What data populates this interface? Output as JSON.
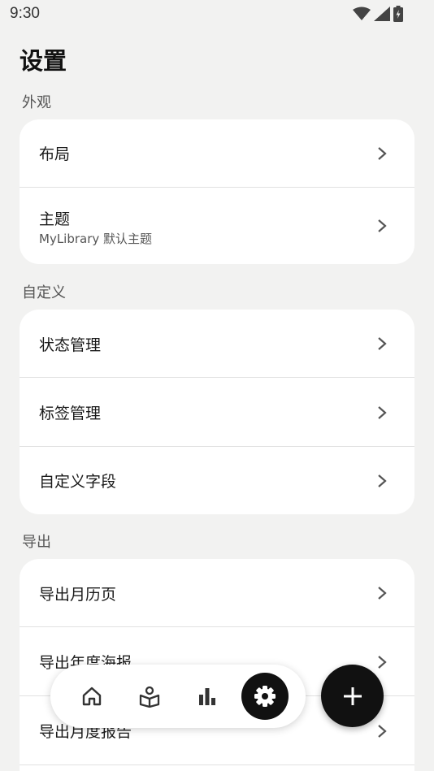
{
  "status_bar": {
    "time": "9:30"
  },
  "page": {
    "title": "设置"
  },
  "sections": [
    {
      "label": "外观",
      "items": [
        {
          "title": "布局"
        },
        {
          "title": "主题",
          "subtitle": "MyLibrary 默认主题"
        }
      ]
    },
    {
      "label": "自定义",
      "items": [
        {
          "title": "状态管理"
        },
        {
          "title": "标签管理"
        },
        {
          "title": "自定义字段"
        }
      ]
    },
    {
      "label": "导出",
      "items": [
        {
          "title": "导出月历页"
        },
        {
          "title": "导出年度海报"
        },
        {
          "title": "导出月度报告"
        }
      ]
    }
  ],
  "bottom_nav": {
    "items": [
      {
        "icon": "home-icon",
        "active": false
      },
      {
        "icon": "reading-icon",
        "active": false
      },
      {
        "icon": "stats-icon",
        "active": false
      },
      {
        "icon": "settings-icon",
        "active": true
      }
    ]
  },
  "fab": {
    "icon": "plus-icon"
  },
  "colors": {
    "background": "#f2f2f1",
    "card": "#ffffff",
    "accent": "#111111",
    "divider": "#e1e1e1"
  }
}
